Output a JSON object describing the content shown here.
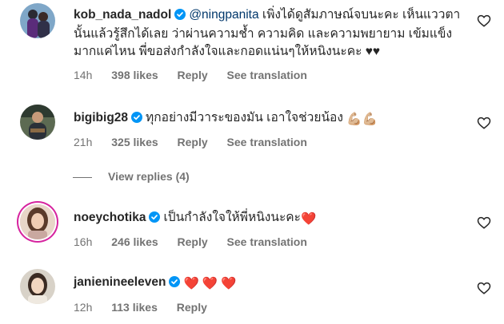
{
  "comments": [
    {
      "username": "kob_nada_nadol",
      "mention": "@ningpanita",
      "text": " เพิ่งได้ดูสัมภาษณ์จบนะคะ เห็นแววตานั้นแล้วรู้สึกได้เลย ว่าผ่านความช้ำ ความคิด และความพยายาม เข้มแข็งมากแค่ไหน พี่ขอส่งกำลังใจและกอดแน่นๆให้หนิงนะคะ ♥♥",
      "time": "14h",
      "likes": "398 likes",
      "reply": "Reply",
      "translation": "See translation",
      "verified": true
    },
    {
      "username": "bigibig28",
      "text": "ทุกอย่างมีวาระของมัน เอาใจช่วยน้อง",
      "emoji": "💪🏼💪🏼",
      "time": "21h",
      "likes": "325 likes",
      "reply": "Reply",
      "translation": "See translation",
      "verified": true
    },
    {
      "username": "noeychotika",
      "text": "เป็นกำลังใจให้พี่หนิงนะคะ",
      "emoji": "❤️",
      "time": "16h",
      "likes": "246 likes",
      "reply": "Reply",
      "translation": "See translation",
      "verified": true
    },
    {
      "username": "janienineeleven",
      "emoji": "❤️❤️❤️",
      "time": "12h",
      "likes": "113 likes",
      "reply": "Reply",
      "verified": true
    }
  ],
  "view_replies": "View replies (4)",
  "colors": {
    "verified": "#0095f6",
    "muted": "#737373",
    "mention": "#00376b",
    "heart": "#ed4956"
  },
  "icons": {
    "like": "heart-outline-icon",
    "verified": "verified-badge-icon"
  }
}
